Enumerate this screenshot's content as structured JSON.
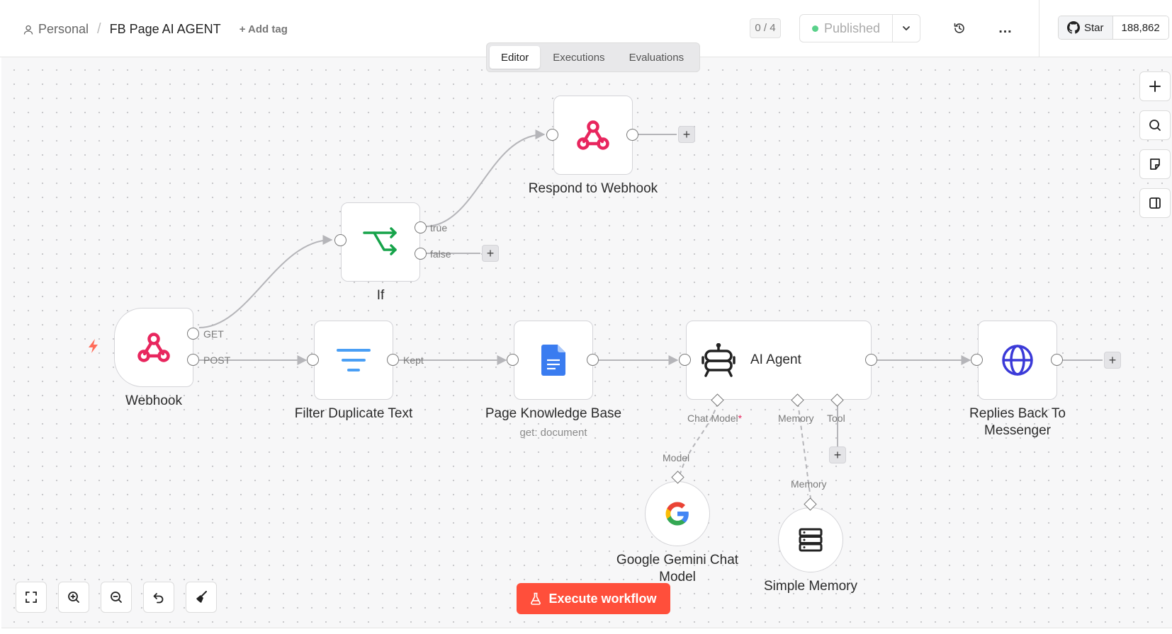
{
  "header": {
    "project": "Personal",
    "separator": "/",
    "workflow_name": "FB Page AI AGENT",
    "add_tag": "+ Add tag",
    "counter": "0 / 4",
    "published_label": "Published",
    "more_label": "…",
    "github": {
      "star_label": "Star",
      "star_count": "188,862"
    }
  },
  "tabs": [
    {
      "label": "Editor",
      "active": true
    },
    {
      "label": "Executions",
      "active": false
    },
    {
      "label": "Evaluations",
      "active": false
    }
  ],
  "nodes": {
    "webhook": {
      "label": "Webhook",
      "icon": "webhook-icon",
      "color": "#e8265e"
    },
    "if": {
      "label": "If",
      "icon": "branch-icon",
      "color": "#16a34a"
    },
    "respond": {
      "label": "Respond to Webhook",
      "icon": "webhook-icon",
      "color": "#e8265e"
    },
    "filter": {
      "label": "Filter Duplicate Text",
      "icon": "filter-icon",
      "color": "#4a9ff5"
    },
    "knowledge": {
      "label": "Page Knowledge Base",
      "sub": "get: document",
      "icon": "google-docs-icon",
      "color": "#3a7cf0"
    },
    "agent": {
      "label": "AI Agent",
      "icon": "robot-icon"
    },
    "replies": {
      "label_line1": "Replies Back To",
      "label_line2": "Messenger",
      "icon": "globe-icon",
      "color": "#3b3ad8"
    },
    "gemini": {
      "label_line1": "Google Gemini Chat",
      "label_line2": "Model",
      "icon": "google-icon"
    },
    "memory": {
      "label": "Simple Memory",
      "icon": "database-icon"
    }
  },
  "ports": {
    "get": "GET",
    "post": "POST",
    "true": "true",
    "false": "false",
    "kept": "Kept",
    "chat_model": "Chat Model",
    "required_mark": "*",
    "memory": "Memory",
    "tool": "Tool",
    "model": "Model",
    "memory_in": "Memory"
  },
  "plus_symbol": "+",
  "execute_button": "Execute workflow",
  "colors": {
    "accent": "#ff4f3b",
    "published_dot": "#5ad18b",
    "trigger": "#ff6d5a"
  }
}
